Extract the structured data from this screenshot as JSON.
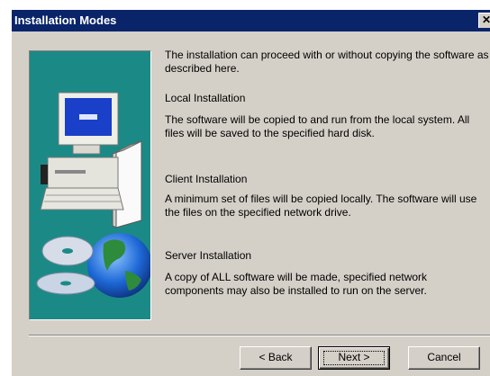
{
  "dialog": {
    "title": "Installation Modes",
    "intro": "The installation can proceed with or without copying the software as\ndescribed here.",
    "local_heading": "Local Installation",
    "local_desc": "The software will be copied to and run from the local system.  All\nfiles will be saved to the specified hard disk.",
    "client_heading": "Client Installation",
    "client_desc": "A minimum set of files will be copied locally.  The software will use\nthe files on the specified network drive.",
    "server_heading": "Server Installation",
    "server_desc": "A copy of ALL software will be made, specified network\ncomponents may also be installed to run on the server."
  },
  "buttons": {
    "back_label": "< Back",
    "next_label": "Next >",
    "cancel_label": "Cancel"
  },
  "icons": {
    "close": "close-icon",
    "computer": "computer-illustration",
    "globe": "globe-illustration",
    "cd": "cd-illustration"
  }
}
